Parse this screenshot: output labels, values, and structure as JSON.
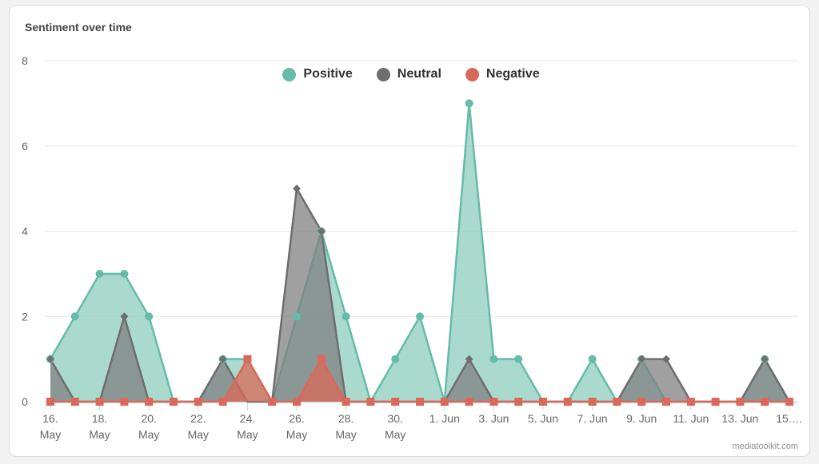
{
  "card": {
    "title": "Sentiment over time",
    "credit": "mediatoolkit.com"
  },
  "chart_data": {
    "type": "area",
    "title": "Sentiment over time",
    "xlabel": "",
    "ylabel": "",
    "ylim": [
      0,
      8
    ],
    "yticks": [
      0,
      2,
      4,
      6,
      8
    ],
    "grid": true,
    "legend_position": "top-center",
    "x": [
      "16. May",
      "17. May",
      "18. May",
      "19. May",
      "20. May",
      "21. May",
      "22. May",
      "23. May",
      "24. May",
      "25. May",
      "26. May",
      "27. May",
      "28. May",
      "29. May",
      "30. May",
      "31. May",
      "1. Jun",
      "2. Jun",
      "3. Jun",
      "4. Jun",
      "5. Jun",
      "6. Jun",
      "7. Jun",
      "8. Jun",
      "9. Jun",
      "10. Jun",
      "11. Jun",
      "12. Jun",
      "13. Jun",
      "14. Jun",
      "15. Jun"
    ],
    "xtick_labels": [
      {
        "index": 0,
        "lines": [
          "16.",
          "May"
        ]
      },
      {
        "index": 2,
        "lines": [
          "18.",
          "May"
        ]
      },
      {
        "index": 4,
        "lines": [
          "20.",
          "May"
        ]
      },
      {
        "index": 6,
        "lines": [
          "22.",
          "May"
        ]
      },
      {
        "index": 8,
        "lines": [
          "24.",
          "May"
        ]
      },
      {
        "index": 10,
        "lines": [
          "26.",
          "May"
        ]
      },
      {
        "index": 12,
        "lines": [
          "28.",
          "May"
        ]
      },
      {
        "index": 14,
        "lines": [
          "30.",
          "May"
        ]
      },
      {
        "index": 16,
        "lines": [
          "1. Jun"
        ]
      },
      {
        "index": 18,
        "lines": [
          "3. Jun"
        ]
      },
      {
        "index": 20,
        "lines": [
          "5. Jun"
        ]
      },
      {
        "index": 22,
        "lines": [
          "7. Jun"
        ]
      },
      {
        "index": 24,
        "lines": [
          "9. Jun"
        ]
      },
      {
        "index": 26,
        "lines": [
          "11. Jun"
        ]
      },
      {
        "index": 28,
        "lines": [
          "13. Jun"
        ]
      },
      {
        "index": 30,
        "lines": [
          "15.…"
        ]
      }
    ],
    "series": [
      {
        "name": "Positive",
        "color": "#65bca9",
        "fill": "#8dcdbe",
        "marker": "circle",
        "values": [
          1,
          2,
          3,
          3,
          2,
          0,
          0,
          1,
          1,
          0,
          2,
          4,
          2,
          0,
          1,
          2,
          0,
          7,
          1,
          1,
          0,
          0,
          1,
          0,
          1,
          0,
          0,
          0,
          0,
          1,
          0
        ]
      },
      {
        "name": "Neutral",
        "color": "#6e6e6e",
        "fill": "#808080",
        "marker": "diamond",
        "values": [
          1,
          0,
          0,
          2,
          0,
          0,
          0,
          1,
          0,
          0,
          5,
          4,
          0,
          0,
          0,
          0,
          0,
          1,
          0,
          0,
          0,
          0,
          0,
          0,
          1,
          1,
          0,
          0,
          0,
          1,
          0
        ]
      },
      {
        "name": "Negative",
        "color": "#d9695a",
        "fill": "#d9695a",
        "marker": "square",
        "values": [
          0,
          0,
          0,
          0,
          0,
          0,
          0,
          0,
          1,
          0,
          0,
          1,
          0,
          0,
          0,
          0,
          0,
          0,
          0,
          0,
          0,
          0,
          0,
          0,
          0,
          0,
          0,
          0,
          0,
          0,
          0
        ]
      }
    ]
  },
  "legend": [
    {
      "label": "Positive",
      "color": "#65bca9"
    },
    {
      "label": "Neutral",
      "color": "#6e6e6e"
    },
    {
      "label": "Negative",
      "color": "#d9695a"
    }
  ]
}
